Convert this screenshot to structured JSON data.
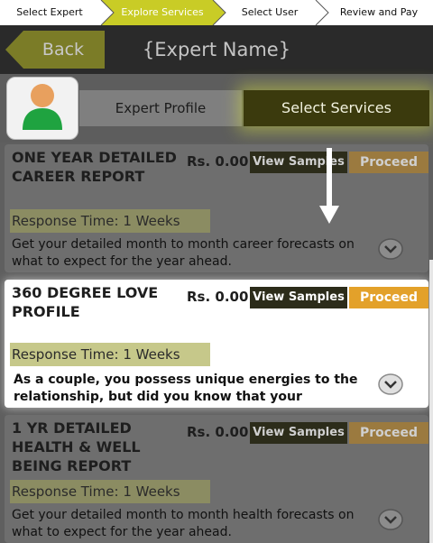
{
  "steps": [
    "Select Expert",
    "Explore Services",
    "Select User",
    "Review and Pay"
  ],
  "active_step": 1,
  "header": {
    "back_label": "Back",
    "title": "{Expert Name}"
  },
  "tabs": {
    "profile_label": "Expert Profile",
    "services_label": "Select Services"
  },
  "colors": {
    "accent_olive": "#c9cc26",
    "proceed_orange": "#e3a12a"
  },
  "icons": [
    "avatar-icon",
    "down-arrow-icon",
    "chevron-down-icon"
  ],
  "services": [
    {
      "title": "ONE YEAR DETAILED CAREER REPORT",
      "price": "Rs. 0.00",
      "samples_label": "View Samples",
      "proceed_label": "Proceed",
      "response": "Response Time: 1 Weeks",
      "description": "Get your detailed month to month career forecasts on what to expect for the year ahead."
    },
    {
      "title": "360 DEGREE LOVE PROFILE",
      "price": "Rs. 0.00",
      "samples_label": "View Samples",
      "proceed_label": "Proceed",
      "response": "Response Time: 1 Weeks",
      "description": "As a couple, you possess unique energies to the relationship, but did you know that your"
    },
    {
      "title": "1 YR DETAILED HEALTH & WELL BEING REPORT",
      "price": "Rs. 0.00",
      "samples_label": "View Samples",
      "proceed_label": "Proceed",
      "response": "Response Time: 1 Weeks",
      "description": "Get your detailed month to month health forecasts on what to expect for the year ahead."
    }
  ]
}
